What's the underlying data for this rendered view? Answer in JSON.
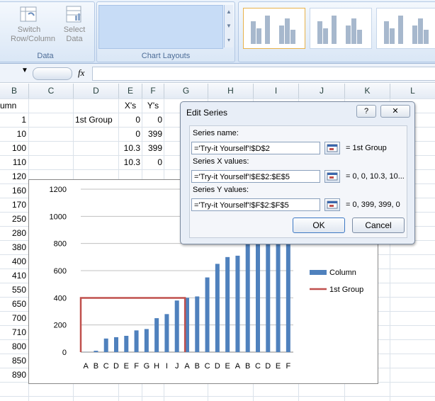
{
  "ribbon": {
    "data_group": {
      "label": "Data",
      "switch_button": [
        "Switch",
        "Row/Column"
      ],
      "select_button": [
        "Select",
        "Data"
      ]
    },
    "chart_layouts_group": {
      "label": "Chart Layouts"
    }
  },
  "formula_bar": {
    "fx": "fx"
  },
  "columns": [
    "B",
    "C",
    "D",
    "E",
    "F",
    "G",
    "H",
    "I",
    "J",
    "K",
    "L"
  ],
  "sheet": {
    "header_row": {
      "B": "umn",
      "E": "X's",
      "F": "Y's"
    },
    "group_label": "1st Group",
    "col_B": [
      "1",
      "10",
      "100",
      "110",
      "120",
      "160",
      "170",
      "250",
      "280",
      "380",
      "400",
      "410",
      "550",
      "650",
      "700",
      "710",
      "800",
      "850",
      "890"
    ],
    "col_E": [
      "0",
      "0",
      "10.3",
      "10.3"
    ],
    "col_F": [
      "0",
      "399",
      "399",
      "0"
    ]
  },
  "dialog": {
    "title": "Edit Series",
    "help": "?",
    "close": "✕",
    "series_name_label": "Series name:",
    "series_name_value": "='Try-it Yourself'!$D$2",
    "series_name_result": "= 1st Group",
    "series_x_label": "Series X values:",
    "series_x_value": "='Try-it Yourself'!$E$2:$E$5",
    "series_x_result": "= 0, 0, 10.3, 10...",
    "series_y_label": "Series Y values:",
    "series_y_value": "='Try-it Yourself'!$F$2:$F$5",
    "series_y_result": "= 0, 399, 399, 0",
    "ok": "OK",
    "cancel": "Cancel"
  },
  "chart_data": {
    "type": "bar",
    "categories": [
      "A",
      "B",
      "C",
      "D",
      "E",
      "F",
      "G",
      "H",
      "I",
      "J",
      "A",
      "B",
      "C",
      "D",
      "E",
      "A",
      "B",
      "C",
      "D",
      "E",
      "F"
    ],
    "series": [
      {
        "name": "Column",
        "type": "bar",
        "color": "#4f81bd",
        "values": [
          1,
          10,
          100,
          110,
          120,
          160,
          170,
          250,
          280,
          380,
          400,
          410,
          550,
          650,
          700,
          710,
          800,
          850,
          890,
          1000,
          1000
        ]
      },
      {
        "name": "1st Group",
        "type": "line",
        "color": "#c0504d",
        "x": [
          0,
          0,
          10.3,
          10.3
        ],
        "y": [
          0,
          399,
          399,
          0
        ]
      }
    ],
    "ylim": [
      0,
      1200
    ],
    "yticks": [
      "0",
      "200",
      "400",
      "600",
      "800",
      "1000",
      "1200"
    ],
    "legend": "right"
  }
}
